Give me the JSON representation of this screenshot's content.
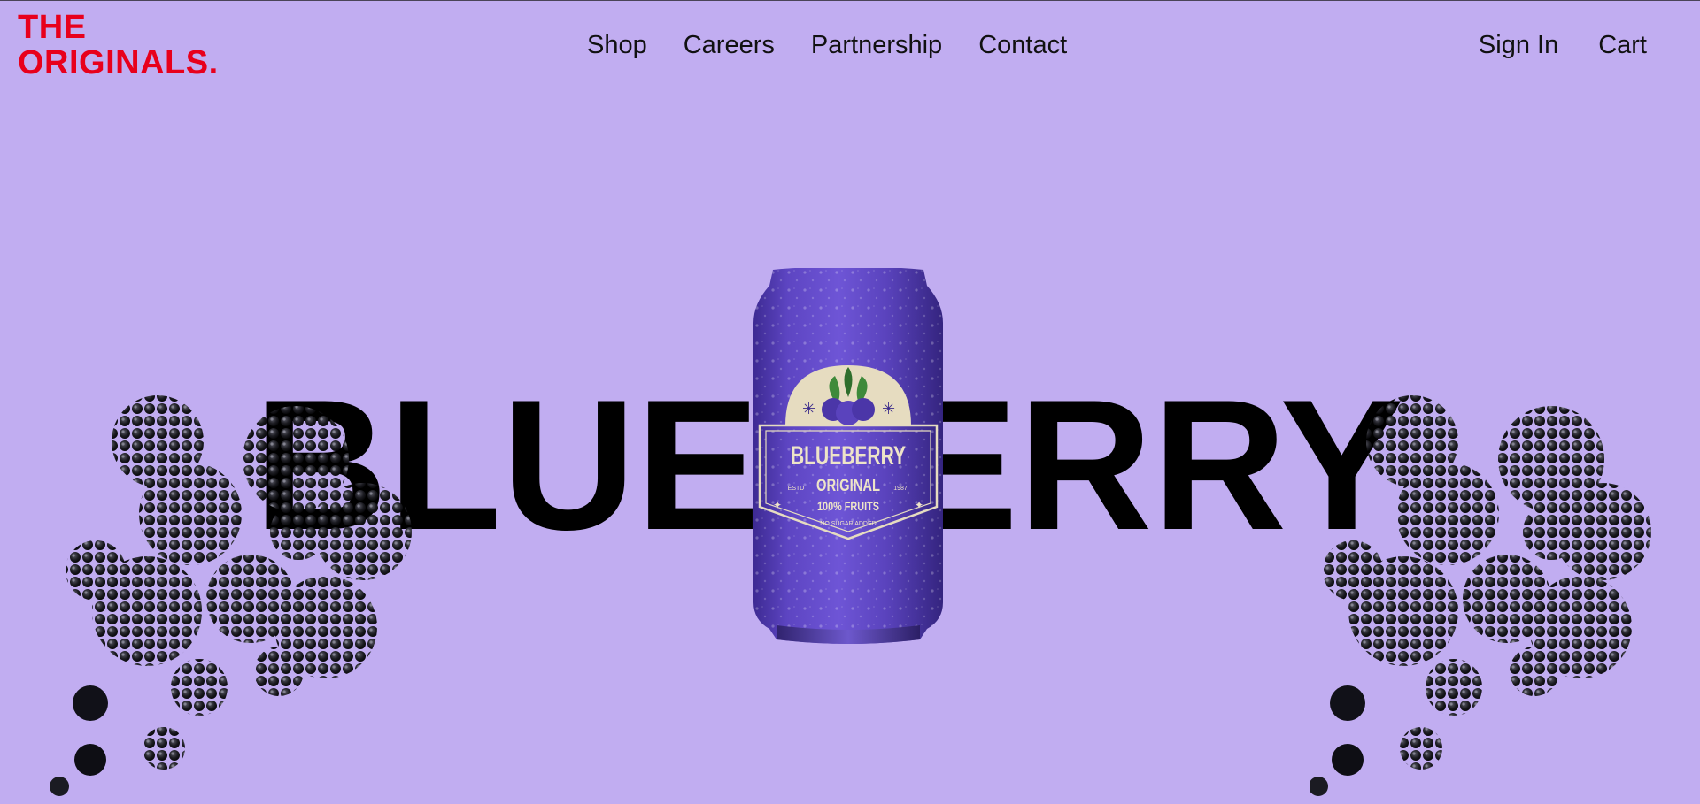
{
  "brand": {
    "line1": "THE",
    "line2": "ORIGINALS.",
    "color": "#e8001c"
  },
  "nav": {
    "items": [
      {
        "label": "Shop"
      },
      {
        "label": "Careers"
      },
      {
        "label": "Partnership"
      },
      {
        "label": "Contact"
      }
    ]
  },
  "account": {
    "sign_in": "Sign In",
    "cart": "Cart"
  },
  "hero": {
    "word": "BLUEBERRY",
    "background": "#c1adf1"
  },
  "can_label": {
    "title": "BLUEBERRY",
    "subtitle": "ORIGINAL",
    "tagline": "100% FRUITS",
    "note": "NO SUGAR ADDED",
    "estd_left": "ESTD",
    "estd_right": "1987"
  }
}
